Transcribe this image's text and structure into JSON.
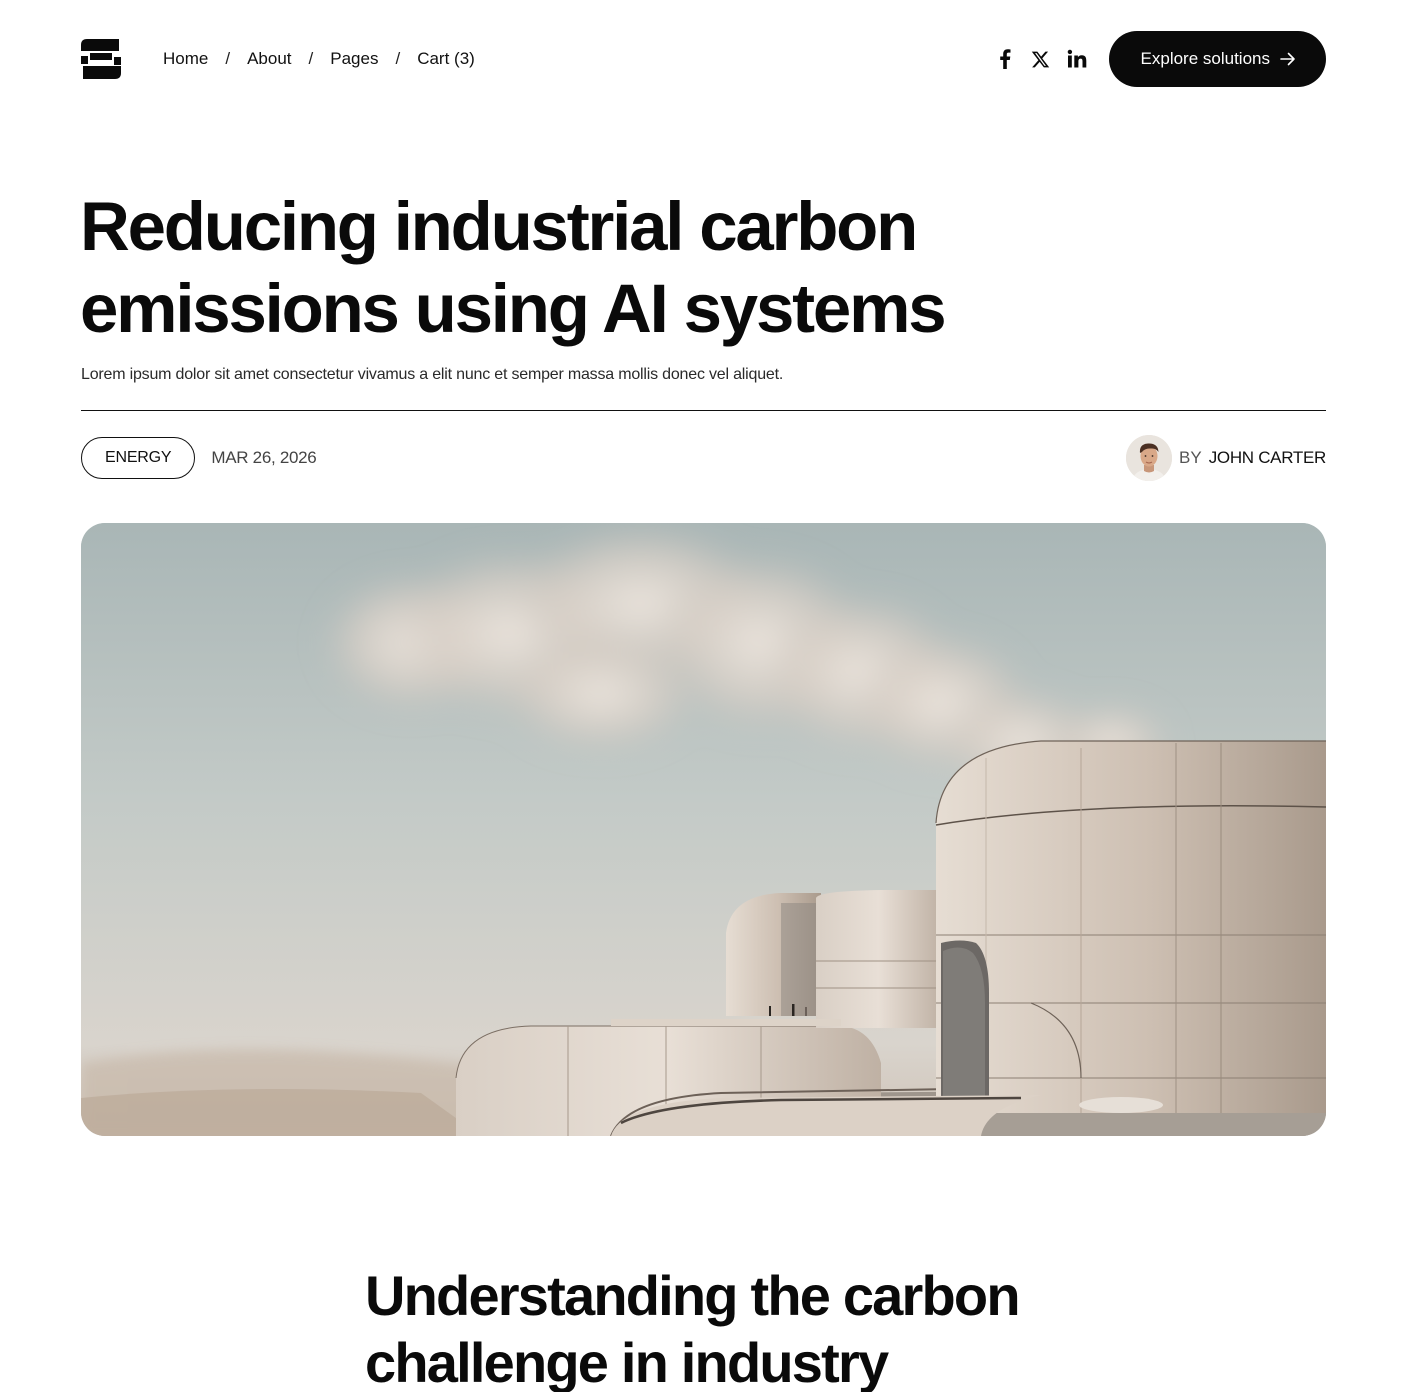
{
  "nav": {
    "items": [
      {
        "label": "Home"
      },
      {
        "label": "About"
      },
      {
        "label": "Pages"
      },
      {
        "label": "Cart (3)"
      }
    ],
    "separator": "/"
  },
  "social": {
    "icons": [
      "facebook-icon",
      "x-icon",
      "linkedin-icon"
    ]
  },
  "cta": {
    "label": "Explore solutions"
  },
  "article": {
    "title_line1": "Reducing industrial carbon",
    "title_line2": "emissions using AI systems",
    "subtitle": "Lorem ipsum dolor sit amet consectetur vivamus a elit nunc et semper massa mollis donec vel aliquet.",
    "category": "ENERGY",
    "date": "MAR 26, 2026",
    "author_prefix": "BY",
    "author": "JOHN CARTER"
  },
  "section": {
    "title_line1": "Understanding the carbon",
    "title_line2": "challenge in industry"
  },
  "colors": {
    "text": "#0b0b0b",
    "button_bg": "#0a0a0a",
    "button_text": "#ffffff"
  }
}
